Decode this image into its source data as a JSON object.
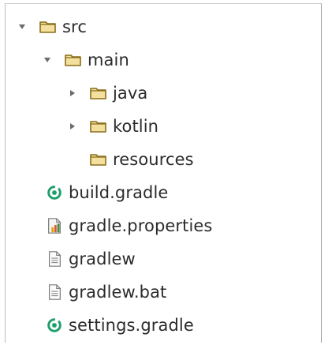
{
  "tree": {
    "src": {
      "label": "src",
      "icon": "folder-icon",
      "expanded": true
    },
    "main": {
      "label": "main",
      "icon": "folder-icon",
      "expanded": true
    },
    "java": {
      "label": "java",
      "icon": "folder-icon",
      "expanded": false
    },
    "kotlin": {
      "label": "kotlin",
      "icon": "folder-icon",
      "expanded": false
    },
    "resources": {
      "label": "resources",
      "icon": "folder-icon"
    },
    "build_gradle": {
      "label": "build.gradle",
      "icon": "gradle-icon"
    },
    "gradle_properties": {
      "label": "gradle.properties",
      "icon": "properties-icon"
    },
    "gradlew": {
      "label": "gradlew",
      "icon": "text-file-icon"
    },
    "gradlew_bat": {
      "label": "gradlew.bat",
      "icon": "text-file-icon"
    },
    "settings_gradle": {
      "label": "settings.gradle",
      "icon": "gradle-icon"
    }
  },
  "colors": {
    "folder_stroke": "#8a6d1a",
    "folder_fill": "#f3df9e",
    "gradle_green": "#1f9f6b",
    "text": "#2b2b2b",
    "arrow": "#6b6b6b"
  }
}
